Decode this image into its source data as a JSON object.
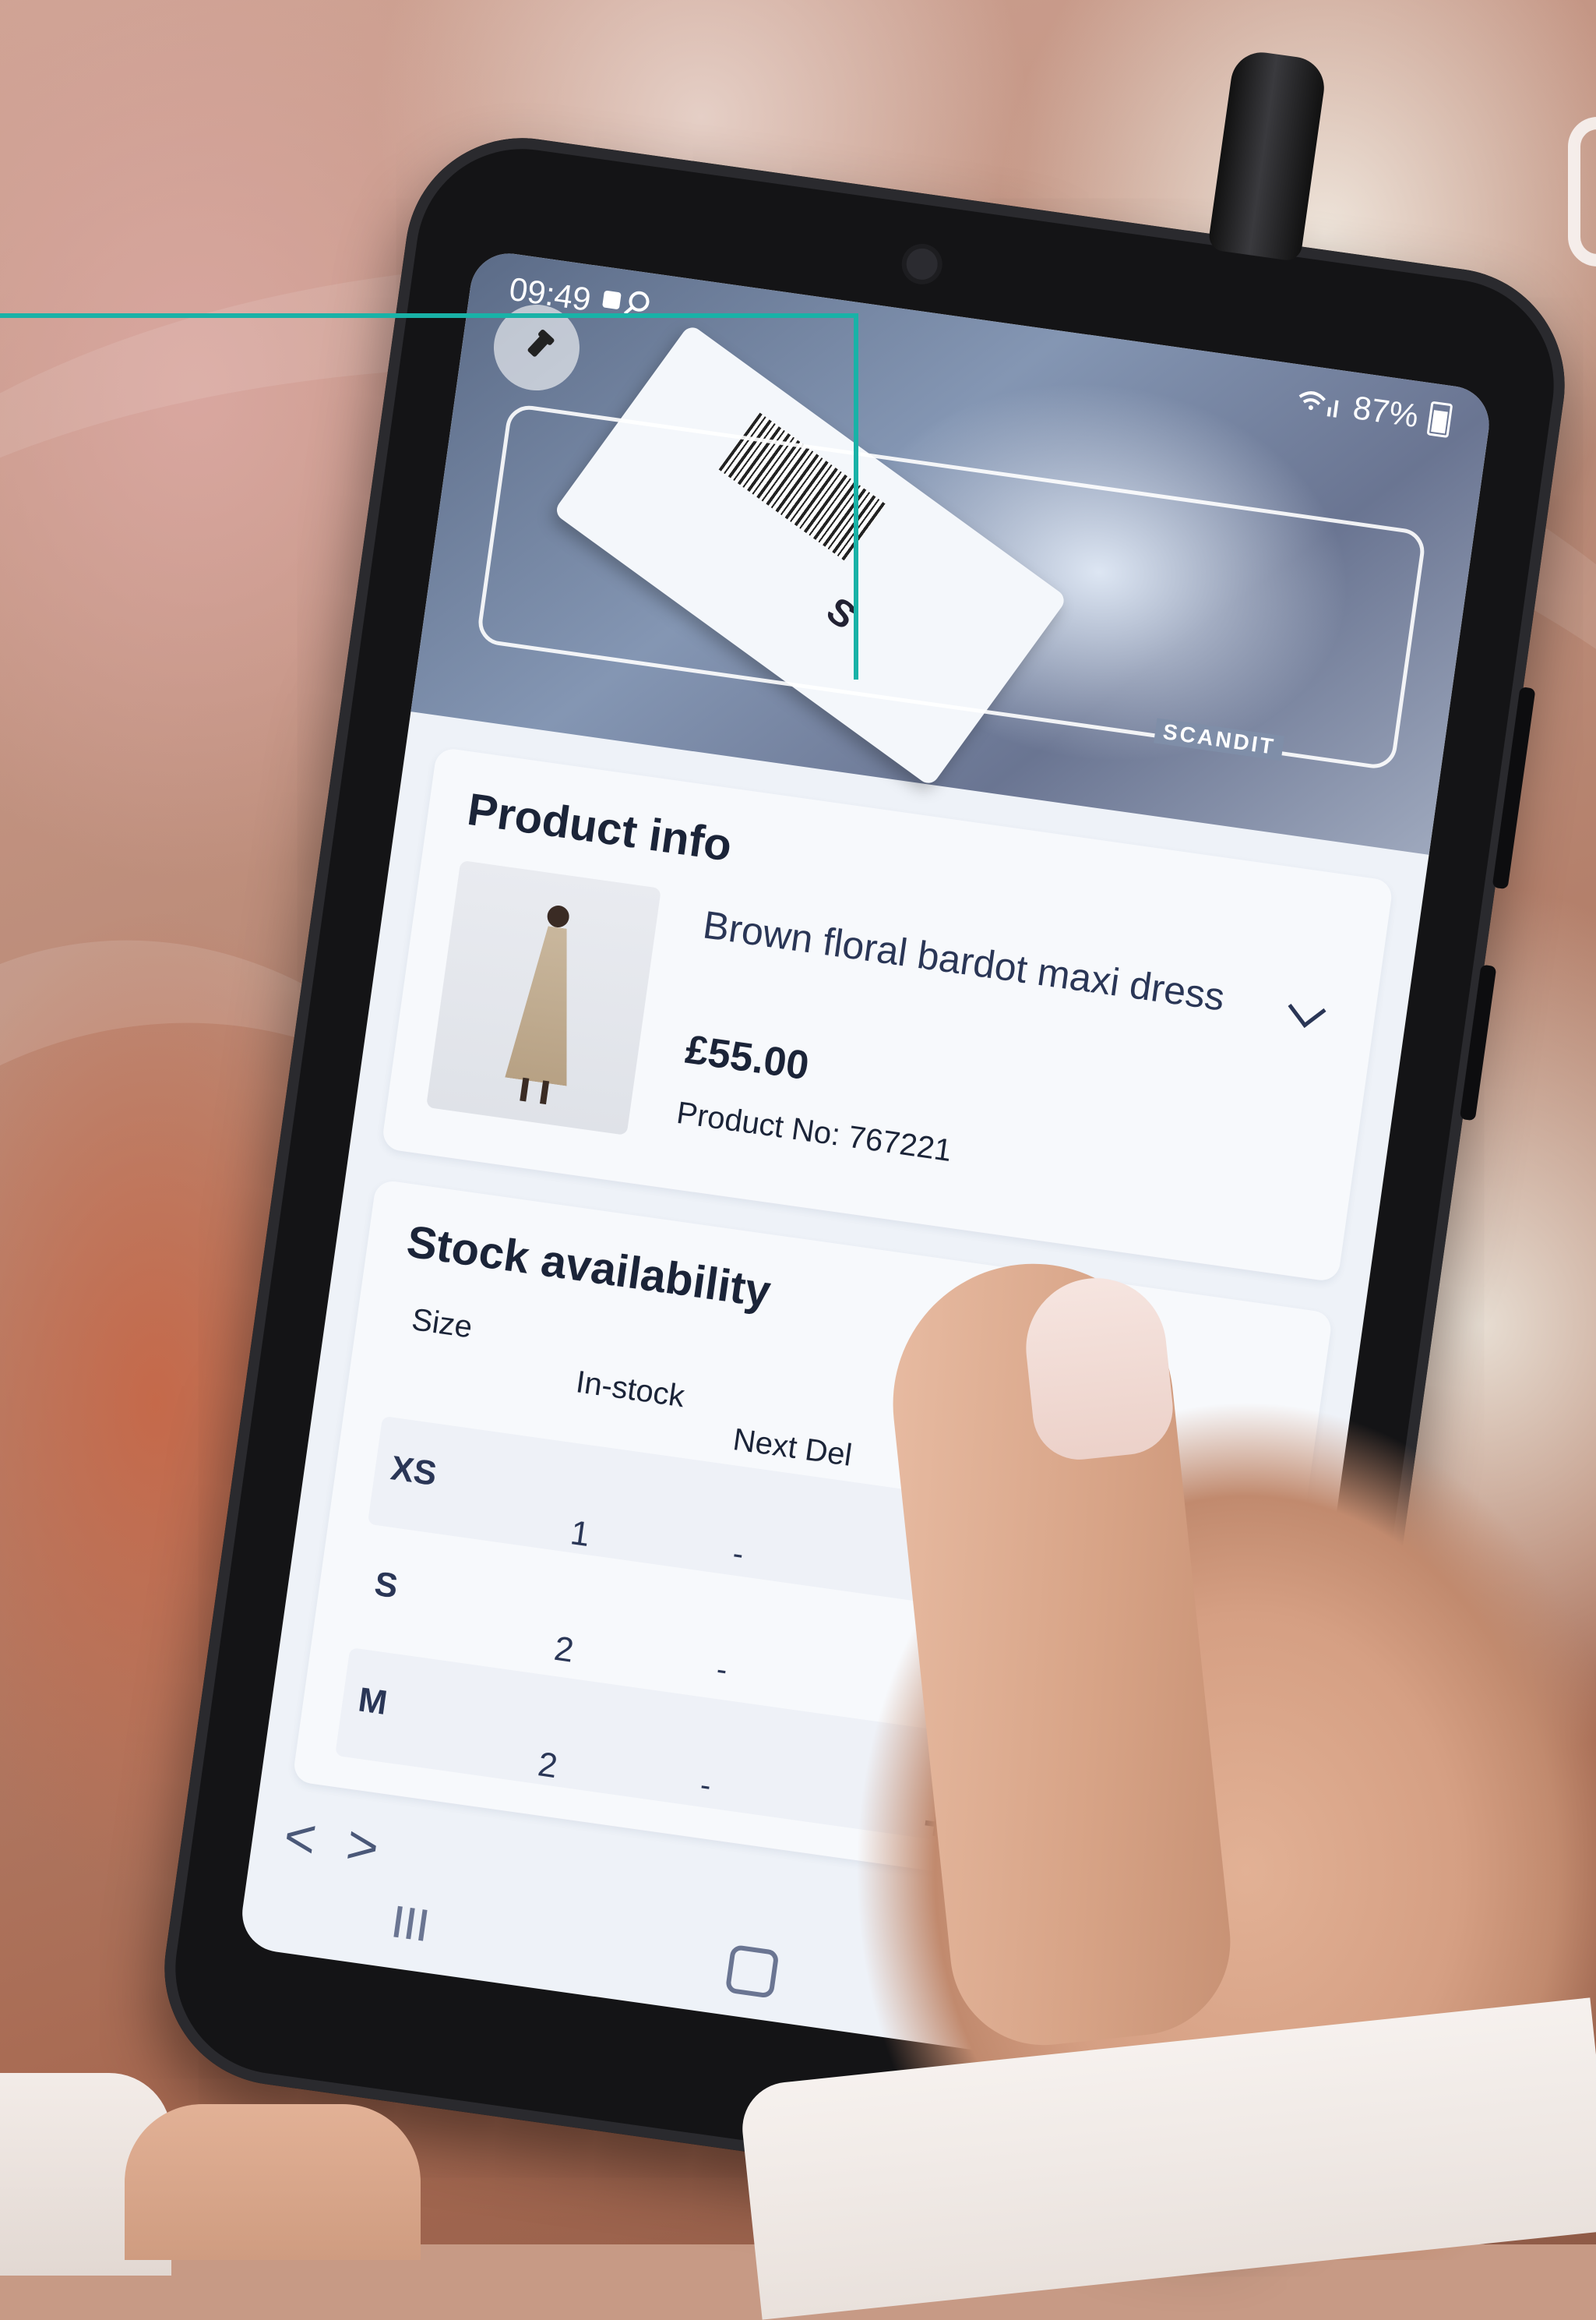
{
  "status_bar": {
    "time": "09:49",
    "battery": "87%"
  },
  "scanner": {
    "brand_label": "SCANDIT",
    "tag_text": "S"
  },
  "product": {
    "title": "Product info",
    "name": "Brown floral bardot maxi dress",
    "price": "£55.00",
    "product_no": "Product No: 767221"
  },
  "stock": {
    "title": "Stock availability",
    "columns": [
      "Size",
      "In-stock",
      "Next Del"
    ],
    "rows": [
      {
        "size": "XS",
        "in_stock": "1",
        "next_del": "-",
        "action": "+"
      },
      {
        "size": "S",
        "in_stock": "2",
        "next_del": "-",
        "action": "+"
      },
      {
        "size": "M",
        "in_stock": "2",
        "next_del": "-",
        "action": "+"
      }
    ]
  },
  "pager": {
    "prev": "<",
    "next": ">"
  },
  "colors": {
    "accent_line": "#19b2a7",
    "text_primary": "#1b2438",
    "screen_bg": "#eef2f8"
  }
}
